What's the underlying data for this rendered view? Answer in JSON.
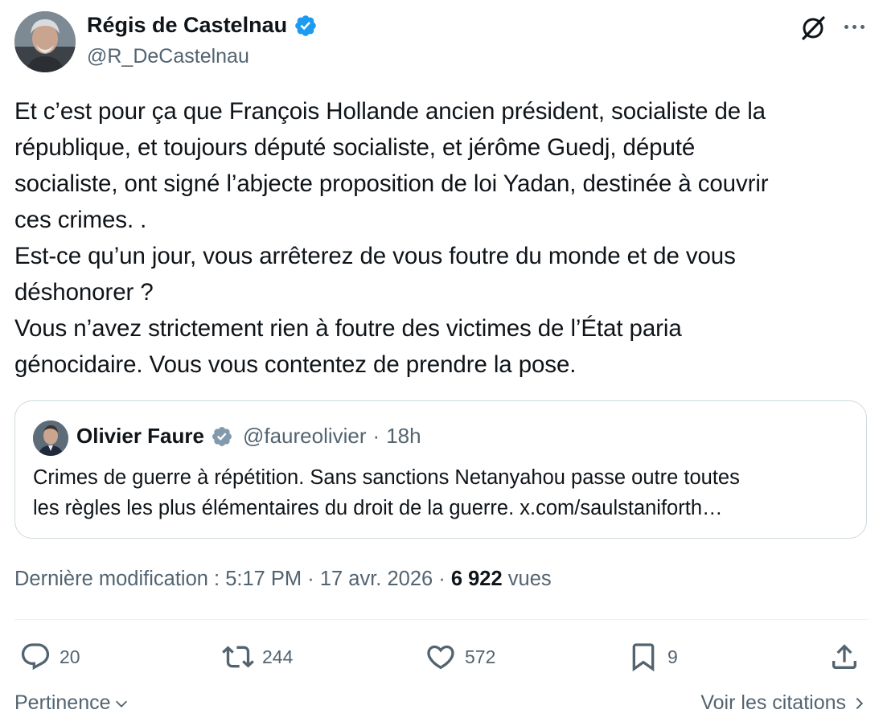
{
  "author": {
    "name": "Régis de Castelnau",
    "handle": "@R_DeCastelnau",
    "verified": true
  },
  "tweet": {
    "text": "Et c’est pour ça que François Hollande ancien président, socialiste de la\nrépublique, et toujours député socialiste, et jérôme Guedj, député\nsocialiste, ont signé l’abjecte proposition de loi Yadan, destinée à couvrir\nces crimes. .\nEst-ce qu’un jour, vous arrêterez de vous foutre du monde et de vous\ndéshonorer ?\nVous n’avez strictement rien à foutre des victimes de l’État paria\ngénocidaire. Vous vous contentez de prendre la pose."
  },
  "quote": {
    "name": "Olivier Faure",
    "handle": "@faureolivier",
    "separator": "·",
    "time": "18h",
    "text": "Crimes de guerre à répétition. Sans sanctions Netanyahou passe outre toutes\nles règles les plus élémentaires du droit de la guerre. x.com/saulstaniforth…"
  },
  "meta": {
    "edited_label": "Dernière modification : 5:17 PM · 17 avr. 2026 ·",
    "views_count": "6 922",
    "views_label": "vues"
  },
  "actions": {
    "replies": "20",
    "reposts": "244",
    "likes": "572",
    "bookmarks": "9"
  },
  "footer": {
    "sort_label": "Pertinence",
    "quotes_label": "Voir les citations"
  },
  "colors": {
    "verified": "#1d9bf0",
    "text": "#0f1419",
    "secondary": "#536471",
    "border": "#cfd9de"
  },
  "icons": [
    "verified-badge-icon",
    "grok-icon",
    "more-icon",
    "reply-icon",
    "repost-icon",
    "like-icon",
    "bookmark-icon",
    "share-icon",
    "chevron-down-icon",
    "chevron-right-icon"
  ]
}
